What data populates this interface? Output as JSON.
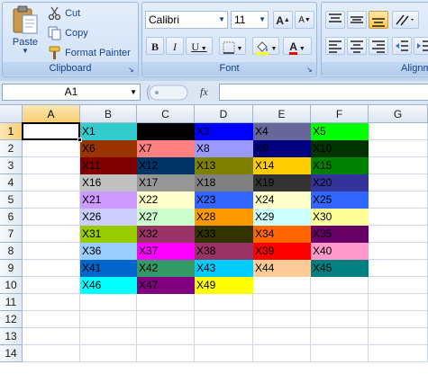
{
  "ribbon": {
    "clipboard": {
      "label": "Clipboard",
      "paste_label": "Paste",
      "cut_label": "Cut",
      "copy_label": "Copy",
      "format_painter_label": "Format Painter"
    },
    "font": {
      "label": "Font",
      "font_name": "Calibri",
      "font_size": "11",
      "bold": "B",
      "italic": "I",
      "underline": "U",
      "grow": "A",
      "shrink": "A",
      "font_color_letter": "A"
    },
    "alignment": {
      "label": "Alignment"
    }
  },
  "formula_bar": {
    "name_box": "A1",
    "fx_label": "fx",
    "formula": ""
  },
  "grid": {
    "columns": [
      "A",
      "B",
      "C",
      "D",
      "E",
      "F",
      "G"
    ],
    "active_column": "A",
    "active_row": 1,
    "rows": [
      "1",
      "2",
      "3",
      "4",
      "5",
      "6",
      "7",
      "8",
      "9",
      "10",
      "11",
      "12",
      "13",
      "14"
    ],
    "cells": [
      {
        "col": 1,
        "row": 1,
        "text": "X1",
        "bg": "#33cccc"
      },
      {
        "col": 2,
        "row": 1,
        "text": "X2",
        "bg": "#000000"
      },
      {
        "col": 3,
        "row": 1,
        "text": "X3",
        "bg": "#0000ff"
      },
      {
        "col": 4,
        "row": 1,
        "text": "X4",
        "bg": "#666699"
      },
      {
        "col": 5,
        "row": 1,
        "text": "X5",
        "bg": "#00ff00"
      },
      {
        "col": 1,
        "row": 2,
        "text": "X6",
        "bg": "#993300"
      },
      {
        "col": 2,
        "row": 2,
        "text": "X7",
        "bg": "#ff8080"
      },
      {
        "col": 3,
        "row": 2,
        "text": "X8",
        "bg": "#9999ff"
      },
      {
        "col": 4,
        "row": 2,
        "text": "X9",
        "bg": "#000080"
      },
      {
        "col": 5,
        "row": 2,
        "text": "X10",
        "bg": "#003300"
      },
      {
        "col": 1,
        "row": 3,
        "text": "X11",
        "bg": "#800000"
      },
      {
        "col": 2,
        "row": 3,
        "text": "X12",
        "bg": "#003366"
      },
      {
        "col": 3,
        "row": 3,
        "text": "X13",
        "bg": "#808000"
      },
      {
        "col": 4,
        "row": 3,
        "text": "X14",
        "bg": "#ffcc00"
      },
      {
        "col": 5,
        "row": 3,
        "text": "X15",
        "bg": "#008000"
      },
      {
        "col": 1,
        "row": 4,
        "text": "X16",
        "bg": "#c0c0c0"
      },
      {
        "col": 2,
        "row": 4,
        "text": "X17",
        "bg": "#969696"
      },
      {
        "col": 3,
        "row": 4,
        "text": "X18",
        "bg": "#808080"
      },
      {
        "col": 4,
        "row": 4,
        "text": "X19",
        "bg": "#333333"
      },
      {
        "col": 5,
        "row": 4,
        "text": "X20",
        "bg": "#333399"
      },
      {
        "col": 1,
        "row": 5,
        "text": "X21",
        "bg": "#cc99ff"
      },
      {
        "col": 2,
        "row": 5,
        "text": "X22",
        "bg": "#ffffcc"
      },
      {
        "col": 3,
        "row": 5,
        "text": "X23",
        "bg": "#3366ff"
      },
      {
        "col": 4,
        "row": 5,
        "text": "X24",
        "bg": "#ffffcc"
      },
      {
        "col": 5,
        "row": 5,
        "text": "X25",
        "bg": "#3366ff"
      },
      {
        "col": 1,
        "row": 6,
        "text": "X26",
        "bg": "#ccccff"
      },
      {
        "col": 2,
        "row": 6,
        "text": "X27",
        "bg": "#ccffcc"
      },
      {
        "col": 3,
        "row": 6,
        "text": "X28",
        "bg": "#ff9900"
      },
      {
        "col": 4,
        "row": 6,
        "text": "X29",
        "bg": "#ccffff"
      },
      {
        "col": 5,
        "row": 6,
        "text": "X30",
        "bg": "#ffff99"
      },
      {
        "col": 1,
        "row": 7,
        "text": "X31",
        "bg": "#99cc00"
      },
      {
        "col": 2,
        "row": 7,
        "text": "X32",
        "bg": "#993366"
      },
      {
        "col": 3,
        "row": 7,
        "text": "X33",
        "bg": "#333300"
      },
      {
        "col": 4,
        "row": 7,
        "text": "X34",
        "bg": "#ff6600"
      },
      {
        "col": 5,
        "row": 7,
        "text": "X35",
        "bg": "#660066"
      },
      {
        "col": 1,
        "row": 8,
        "text": "X36",
        "bg": "#99ccff"
      },
      {
        "col": 2,
        "row": 8,
        "text": "X37",
        "bg": "#ff00ff"
      },
      {
        "col": 3,
        "row": 8,
        "text": "X38",
        "bg": "#993366"
      },
      {
        "col": 4,
        "row": 8,
        "text": "X39",
        "bg": "#ff0000"
      },
      {
        "col": 5,
        "row": 8,
        "text": "X40",
        "bg": "#ff99cc"
      },
      {
        "col": 1,
        "row": 9,
        "text": "X41",
        "bg": "#0066cc"
      },
      {
        "col": 2,
        "row": 9,
        "text": "X42",
        "bg": "#339966"
      },
      {
        "col": 3,
        "row": 9,
        "text": "X43",
        "bg": "#00ccff"
      },
      {
        "col": 4,
        "row": 9,
        "text": "X44",
        "bg": "#ffcc99"
      },
      {
        "col": 5,
        "row": 9,
        "text": "X45",
        "bg": "#008080"
      },
      {
        "col": 1,
        "row": 10,
        "text": "X46",
        "bg": "#00ffff"
      },
      {
        "col": 2,
        "row": 10,
        "text": "X47",
        "bg": "#800080"
      },
      {
        "col": 3,
        "row": 10,
        "text": "X49",
        "bg": "#ffff00"
      }
    ]
  }
}
